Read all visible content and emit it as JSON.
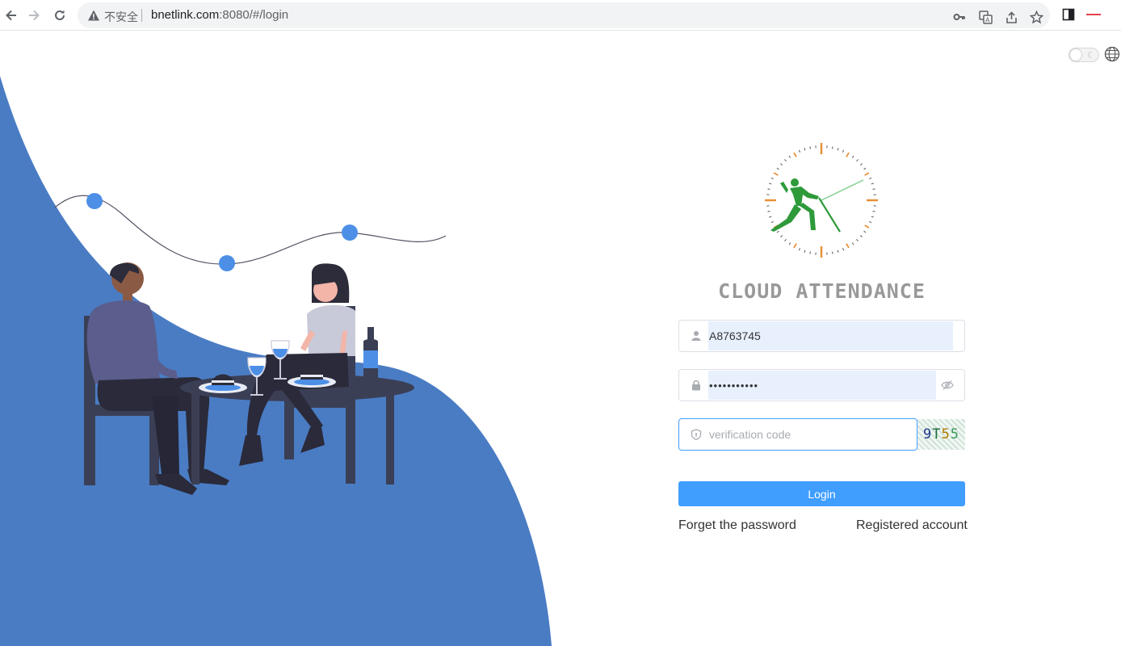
{
  "browser": {
    "insecure_label": "不安全",
    "url_host": "bnetlink.com",
    "url_rest": ":8080/#/login",
    "icons": [
      "back-icon",
      "forward-icon",
      "reload-icon",
      "warning-icon",
      "key-icon",
      "translate-icon",
      "share-icon",
      "star-icon",
      "sidepanel-icon",
      "extension-icon"
    ]
  },
  "header": {
    "theme_toggle_icon": "moon-icon",
    "language_icon": "globe-icon"
  },
  "login": {
    "title": "CLOUD ATTENDANCE",
    "username_value": "A8763745",
    "password_value": "•••••••••••",
    "code_placeholder": "verification code",
    "captcha_chars": [
      "9",
      "T",
      "5",
      "5"
    ],
    "captcha_colors": [
      "#1f3a8a",
      "#1a6b3a",
      "#b07b00",
      "#3a9b5a"
    ],
    "login_label": "Login",
    "forget_label": "Forget the password",
    "register_label": "Registered account"
  },
  "theme": {
    "accent": "#409eff",
    "hero_blue": "#4a7cc4",
    "autofill_bg": "#e8f0fe",
    "logo_green": "#2e9a3a",
    "logo_orange": "#e8903a"
  }
}
